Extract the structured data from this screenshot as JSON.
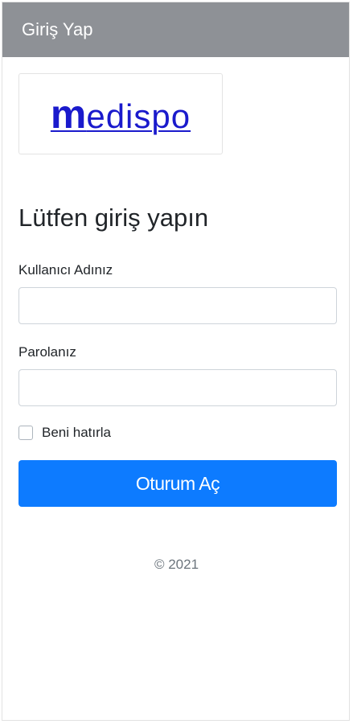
{
  "header": {
    "title": "Giriş Yap",
    "background_color": "#8e9196"
  },
  "logo": {
    "first_letter": "m",
    "rest": "edispo",
    "color": "#1a1acc"
  },
  "form": {
    "heading": "Lütfen giriş yapın",
    "username_label": "Kullanıcı Adınız",
    "username_value": "",
    "password_label": "Parolanız",
    "password_value": "",
    "remember_label": "Beni hatırla",
    "remember_checked": false,
    "submit_label": "Oturum Aç",
    "submit_color": "#0d7bff"
  },
  "footer": {
    "copyright": "© 2021"
  }
}
